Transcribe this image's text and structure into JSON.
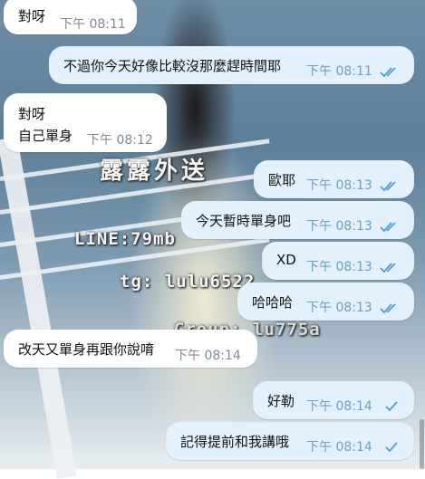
{
  "messages": [
    {
      "id": "m1",
      "dir": "in",
      "text": "對呀",
      "time": "下午 08:11"
    },
    {
      "id": "m2",
      "dir": "out",
      "text": "不過你今天好像比較沒那麼趕時間耶",
      "time": "下午 08:11",
      "status": "read"
    },
    {
      "id": "m3",
      "dir": "in",
      "line1": "對呀",
      "line2": "自己單身",
      "time": "下午 08:12"
    },
    {
      "id": "m4",
      "dir": "out",
      "text": "歐耶",
      "time": "下午 08:13",
      "status": "read"
    },
    {
      "id": "m5",
      "dir": "out",
      "text": "今天暫時單身吧",
      "time": "下午 08:13",
      "status": "read"
    },
    {
      "id": "m6",
      "dir": "out",
      "text": "XD",
      "time": "下午 08:13",
      "status": "read"
    },
    {
      "id": "m7",
      "dir": "out",
      "text": "哈哈哈",
      "time": "下午 08:13",
      "status": "read"
    },
    {
      "id": "m8",
      "dir": "in",
      "text": "改天又單身再跟你說唷",
      "time": "下午 08:14"
    },
    {
      "id": "m9",
      "dir": "out",
      "text": "好勒",
      "time": "下午 08:14",
      "status": "sent"
    },
    {
      "id": "m10",
      "dir": "out",
      "text": "記得提前和我講哦",
      "time": "下午 08:14",
      "status": "sent"
    }
  ],
  "watermark": {
    "brand": "露露外送",
    "line": "LINE:79mb",
    "tg": "tg: lulu6522",
    "group": "Group: lu775a"
  },
  "colors": {
    "incoming": "#ffffff",
    "outgoing": "#e3f1fc",
    "check": "#4a9bd6",
    "time": "#7e8a96"
  }
}
